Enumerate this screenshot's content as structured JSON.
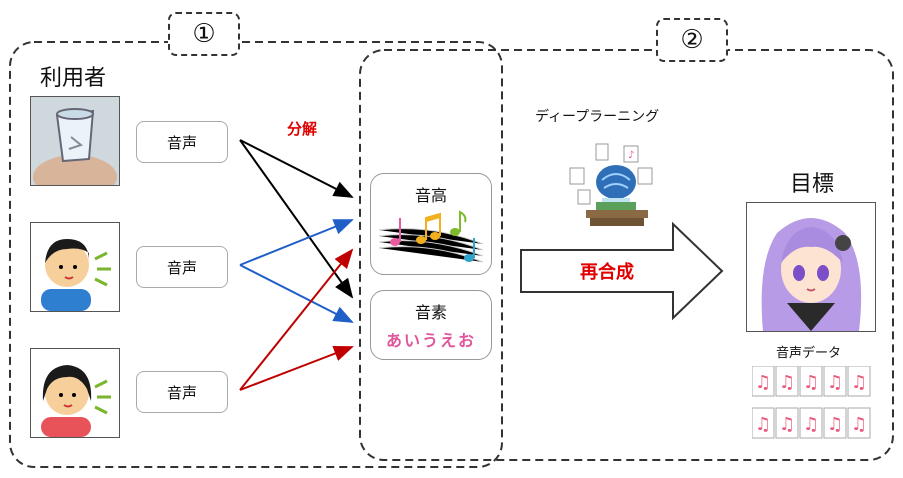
{
  "regions": {
    "region1_label": "①",
    "region2_label": "②"
  },
  "users": {
    "title": "利用者",
    "voice_label": "音声"
  },
  "decompose_label": "分解",
  "features": {
    "pitch": {
      "label": "音高"
    },
    "phoneme": {
      "label": "音素",
      "text": "あいうえお"
    }
  },
  "deep_learning_label": "ディープラーニング",
  "resynthesis_label": "再合成",
  "target": {
    "title": "目標",
    "voice_data_label": "音声データ"
  },
  "colors": {
    "black_arrow": "#000000",
    "blue_arrow": "#1f5fc8",
    "red_arrow": "#c00000",
    "accent_red": "#e00000"
  }
}
